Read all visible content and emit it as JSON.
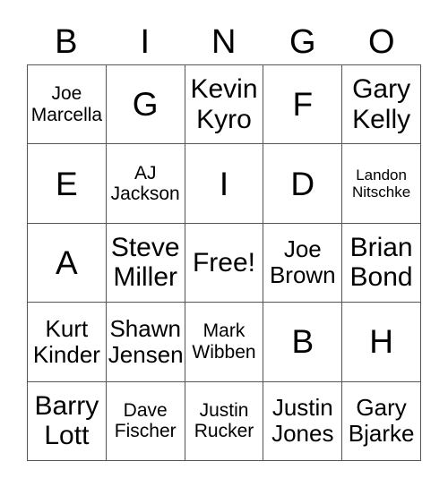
{
  "card": {
    "title_letters": [
      "B",
      "I",
      "N",
      "G",
      "O"
    ],
    "border_color": "#555555",
    "text_color": "#000000",
    "background_color": "#ffffff",
    "columns": 5,
    "rows": 5,
    "free_space_label": "Free!",
    "free_space_position": {
      "row": 3,
      "column": 3
    },
    "cells": [
      [
        {
          "text": "Joe\nMarcella",
          "size": "sm"
        },
        {
          "text": "G",
          "size": "xl"
        },
        {
          "text": "Kevin\nKyro",
          "size": "lg"
        },
        {
          "text": "F",
          "size": "xl"
        },
        {
          "text": "Gary\nKelly",
          "size": "lg"
        }
      ],
      [
        {
          "text": "E",
          "size": "xl"
        },
        {
          "text": "AJ\nJackson",
          "size": "sm"
        },
        {
          "text": "I",
          "size": "xl"
        },
        {
          "text": "D",
          "size": "xl"
        },
        {
          "text": "Landon\nNitschke",
          "size": "xs"
        }
      ],
      [
        {
          "text": "A",
          "size": "xl"
        },
        {
          "text": "Steve\nMiller",
          "size": "lg"
        },
        {
          "text": "Free!",
          "size": "lg"
        },
        {
          "text": "Joe\nBrown",
          "size": "md"
        },
        {
          "text": "Brian\nBond",
          "size": "lg"
        }
      ],
      [
        {
          "text": "Kurt\nKinder",
          "size": "md"
        },
        {
          "text": "Shawn\nJensen",
          "size": "md"
        },
        {
          "text": "Mark\nWibben",
          "size": "sm"
        },
        {
          "text": "B",
          "size": "xl"
        },
        {
          "text": "H",
          "size": "xl"
        }
      ],
      [
        {
          "text": "Barry\nLott",
          "size": "lg"
        },
        {
          "text": "Dave\nFischer",
          "size": "sm"
        },
        {
          "text": "Justin\nRucker",
          "size": "sm"
        },
        {
          "text": "Justin\nJones",
          "size": "md"
        },
        {
          "text": "Gary\nBjarke",
          "size": "md"
        }
      ]
    ]
  }
}
